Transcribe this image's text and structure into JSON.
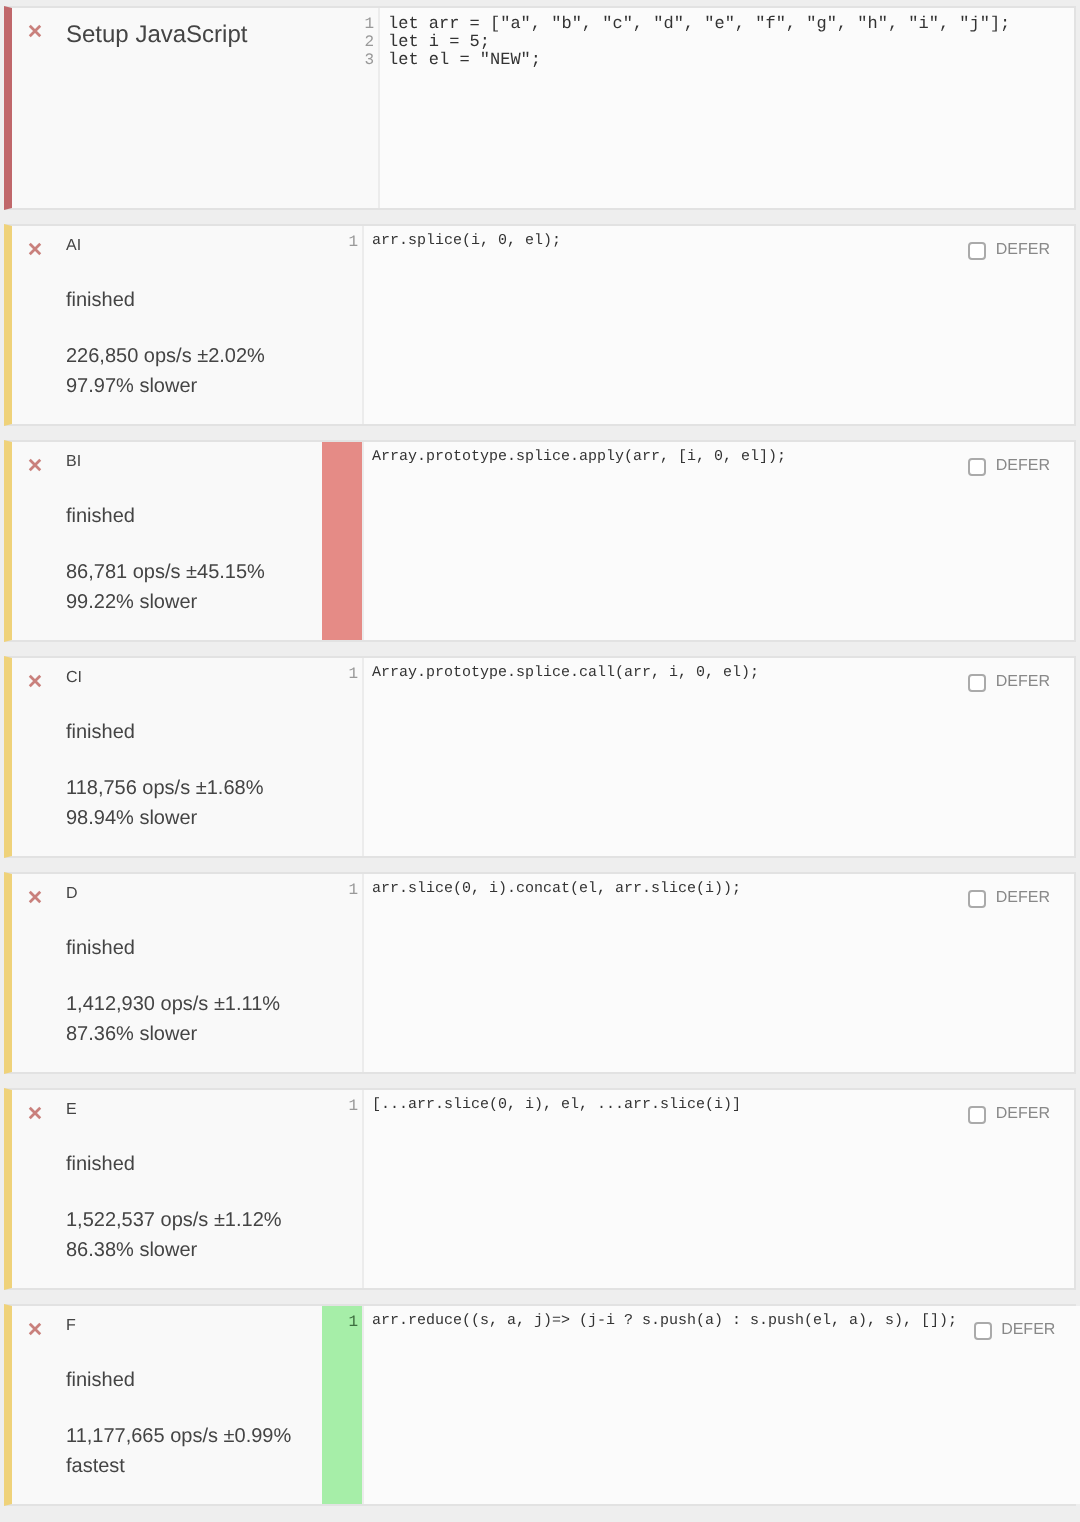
{
  "setup": {
    "title": "Setup JavaScript",
    "code": [
      "let arr = [\"a\", \"b\", \"c\", \"d\", \"e\", \"f\", \"g\", \"h\", \"i\", \"j\"];",
      "let i = 5;",
      "let el = \"NEW\";"
    ],
    "line_numbers": [
      "1",
      "2",
      "3"
    ]
  },
  "tests": [
    {
      "title": "AI",
      "status": "finished",
      "ops": "226,850 ops/s ±2.02%",
      "relative": "97.97% slower",
      "line_number": "1",
      "code": "arr.splice(i, 0, el);",
      "slowest": false,
      "fastest": false,
      "defer": {
        "label": "DEFER",
        "checked": false
      }
    },
    {
      "title": "BI",
      "status": "finished",
      "ops": "86,781 ops/s ±45.15%",
      "relative": "99.22% slower",
      "code": "Array.prototype.splice.apply(arr, [i, 0, el]);",
      "slowest": true,
      "fastest": false,
      "defer": {
        "label": "DEFER",
        "checked": false
      }
    },
    {
      "title": "CI",
      "status": "finished",
      "ops": "118,756 ops/s ±1.68%",
      "relative": "98.94% slower",
      "line_number": "1",
      "code": "Array.prototype.splice.call(arr, i, 0, el);",
      "slowest": false,
      "fastest": false,
      "defer": {
        "label": "DEFER",
        "checked": false
      }
    },
    {
      "title": "D",
      "status": "finished",
      "ops": "1,412,930 ops/s ±1.11%",
      "relative": "87.36% slower",
      "line_number": "1",
      "code": "arr.slice(0, i).concat(el, arr.slice(i));",
      "slowest": false,
      "fastest": false,
      "defer": {
        "label": "DEFER",
        "checked": false
      }
    },
    {
      "title": "E",
      "status": "finished",
      "ops": "1,522,537 ops/s ±1.12%",
      "relative": "86.38% slower",
      "line_number": "1",
      "code": "[...arr.slice(0, i), el, ...arr.slice(i)]",
      "slowest": false,
      "fastest": false,
      "defer": {
        "label": "DEFER",
        "checked": false
      }
    },
    {
      "title": "F",
      "status": "finished",
      "ops": "11,177,665 ops/s ±0.99%",
      "relative": "fastest",
      "line_number": "1",
      "code": "arr.reduce((s, a, j)=> (j-i ? s.push(a) : s.push(el, a), s), []);",
      "slowest": false,
      "fastest": true,
      "defer": {
        "label": "DEFER",
        "checked": false
      }
    }
  ]
}
